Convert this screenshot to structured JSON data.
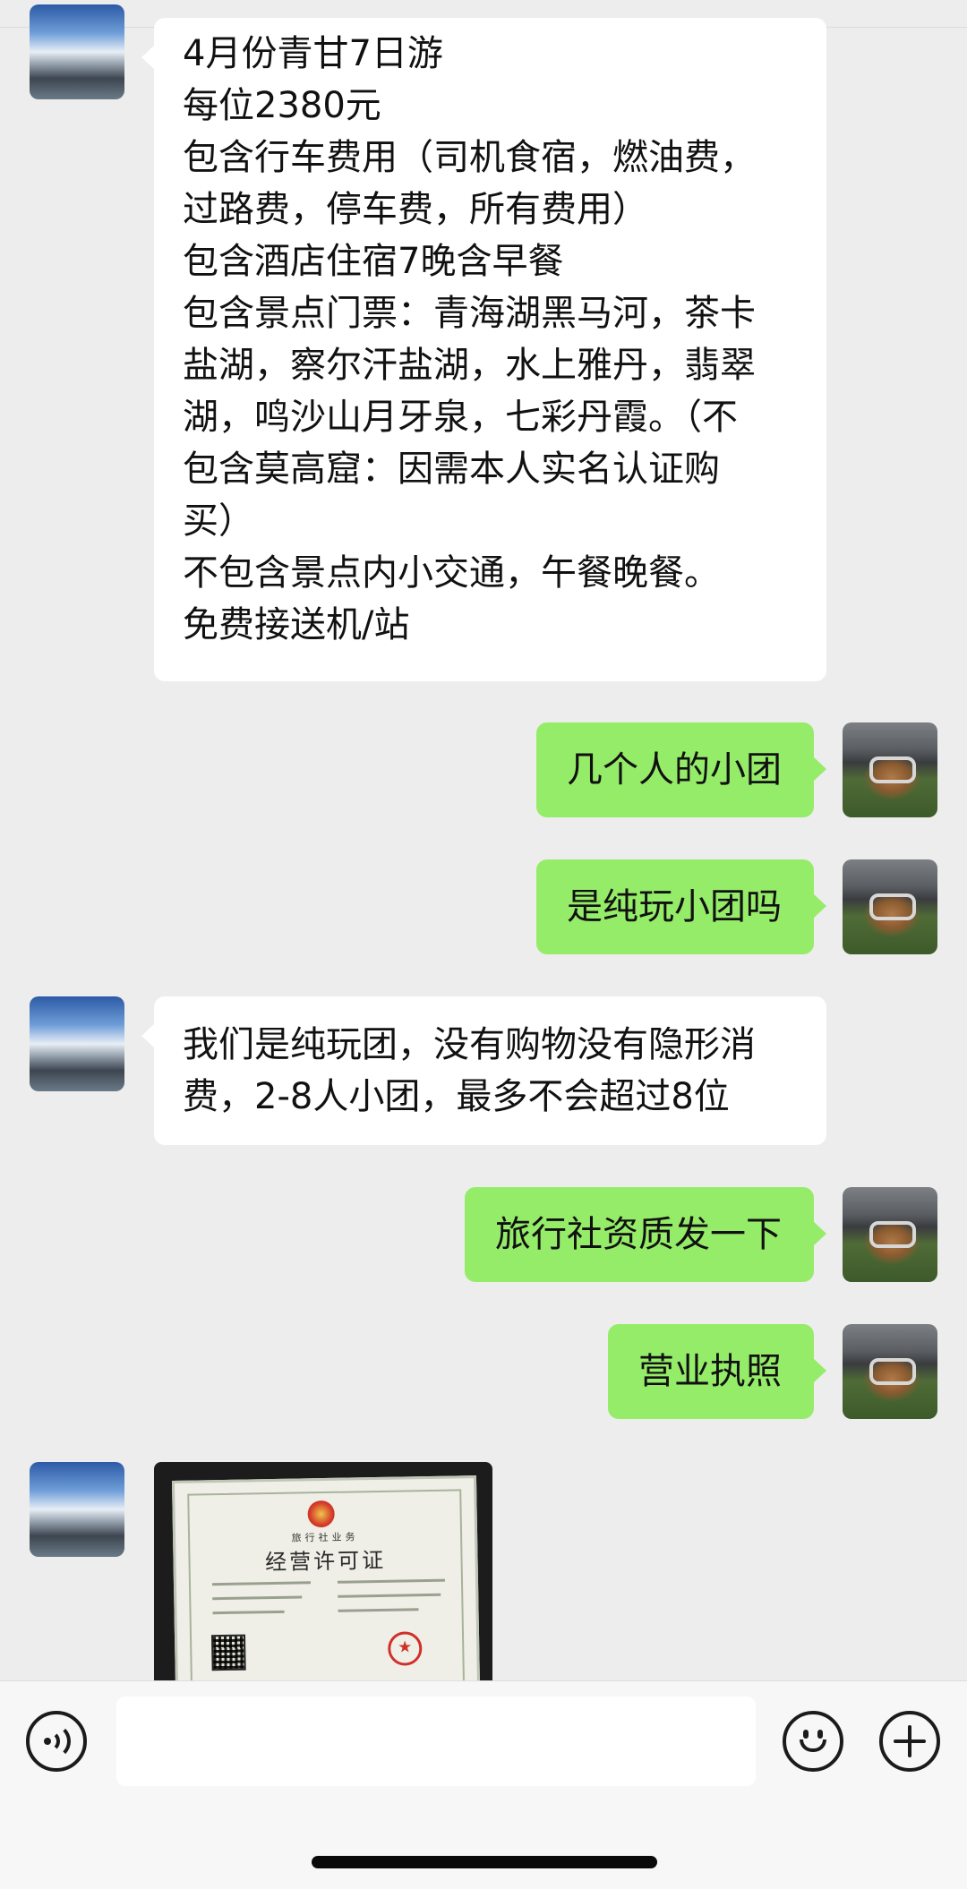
{
  "messages": [
    {
      "sender": "other",
      "lines": [
        "4月份青甘7日游",
        "每位2380元",
        "包含行车费用（司机食宿，燃油费，",
        "过路费，停车费，所有费用）",
        "包含酒店住宿7晚含早餐",
        "包含景点门票：青海湖黑马河，茶卡",
        "盐湖，察尔汗盐湖，水上雅丹，翡翠",
        "湖，鸣沙山月牙泉，七彩丹霞。（不",
        "包含莫高窟：因需本人实名认证购",
        "买）",
        "不包含景点内小交通，午餐晚餐。",
        "免费接送机/站"
      ]
    },
    {
      "sender": "self",
      "text": "几个人的小团"
    },
    {
      "sender": "self",
      "text": "是纯玩小团吗"
    },
    {
      "sender": "other",
      "lines": [
        "我们是纯玩团，没有购物没有隐形消",
        "费，2-8人小团，最多不会超过8位"
      ]
    },
    {
      "sender": "self",
      "text": "旅行社资质发一下"
    },
    {
      "sender": "self",
      "text": "营业执照"
    },
    {
      "sender": "other",
      "image": {
        "subtitle": "旅行社业务",
        "title": "经营许可证"
      }
    }
  ],
  "input_bar": {
    "voice_icon": "voice-icon",
    "emoji_icon": "emoji-icon",
    "plus_icon": "plus-icon",
    "placeholder": ""
  }
}
